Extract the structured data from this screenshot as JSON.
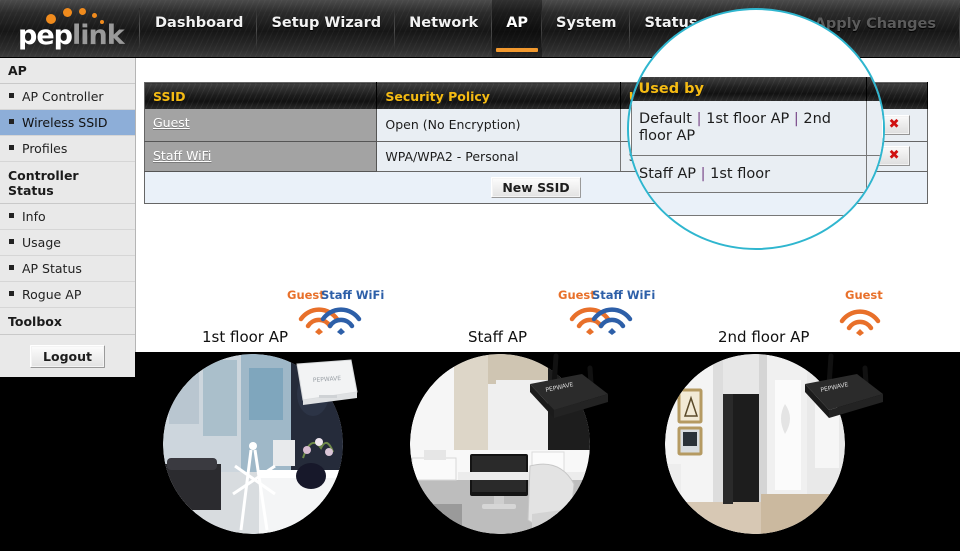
{
  "brand": {
    "name_part1": "pep",
    "name_part2": "link"
  },
  "topbar": {
    "nav": [
      {
        "label": "Dashboard",
        "active": false
      },
      {
        "label": "Setup Wizard",
        "active": false
      },
      {
        "label": "Network",
        "active": false
      },
      {
        "label": "AP",
        "active": true
      },
      {
        "label": "System",
        "active": false
      },
      {
        "label": "Status",
        "active": false
      }
    ],
    "apply_changes_label": "Apply Changes"
  },
  "sidebar": {
    "groups": [
      {
        "title": "AP",
        "items": [
          {
            "label": "AP Controller",
            "selected": false
          },
          {
            "label": "Wireless SSID",
            "selected": true
          },
          {
            "label": "Profiles",
            "selected": false
          }
        ]
      },
      {
        "title": "Controller Status",
        "items": [
          {
            "label": "Info",
            "selected": false
          },
          {
            "label": "Usage",
            "selected": false
          },
          {
            "label": "AP Status",
            "selected": false
          },
          {
            "label": "Rogue AP",
            "selected": false
          }
        ]
      },
      {
        "title": "Toolbox",
        "items": []
      }
    ],
    "logout_label": "Logout"
  },
  "ssid_table": {
    "headers": [
      "SSID",
      "Security Policy",
      "Used by",
      ""
    ],
    "rows": [
      {
        "ssid": "Guest",
        "security": "Open (No Encryption)",
        "used_by": "Default | 1st floor AP | 2nd floor AP",
        "delete_icon": "red-x-icon"
      },
      {
        "ssid": "Staff WiFi",
        "security": "WPA/WPA2 - Personal",
        "used_by": "Staff AP | 1st floor",
        "delete_icon": "red-x-icon"
      }
    ],
    "new_ssid_label": "New SSID"
  },
  "magnifier": {
    "header": "Used by",
    "row1": "Default | 1st floor AP | 2nd floor AP",
    "row2": "Staff AP | 1st floor",
    "border_color": "#2fb6cf"
  },
  "diagram": {
    "access_points": [
      {
        "name": "1st floor AP",
        "ssids": [
          {
            "label": "Guest",
            "color": "#e8702a"
          },
          {
            "label": "Staff WiFi",
            "color": "#2d5fa8"
          }
        ],
        "device": "PEPWAVE"
      },
      {
        "name": "Staff AP",
        "ssids": [
          {
            "label": "Guest",
            "color": "#e8702a"
          },
          {
            "label": "Staff WiFi",
            "color": "#2d5fa8"
          }
        ],
        "device": "PEPWAVE"
      },
      {
        "name": "2nd floor AP",
        "ssids": [
          {
            "label": "Guest",
            "color": "#e8702a"
          }
        ],
        "device": "PEPWAVE"
      }
    ]
  },
  "colors": {
    "accent_orange": "#f2992e",
    "header_yellow": "#f5bb13",
    "link_white": "#ffffff",
    "selected_blue": "#8daed8",
    "delete_red": "#d01010",
    "circle_cyan": "#2fb6cf"
  }
}
